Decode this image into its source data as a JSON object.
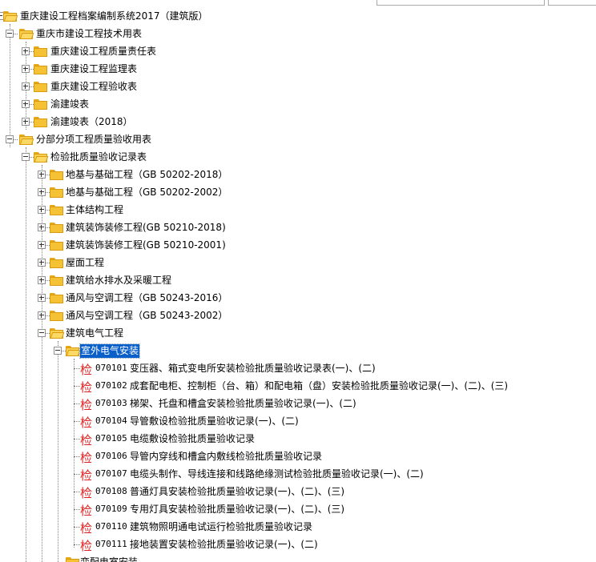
{
  "tree": {
    "root": "重庆建设工程档案编制系统2017（建筑版）",
    "group1": {
      "label": "重庆市建设工程技术用表",
      "items": [
        "重庆建设工程质量责任表",
        "重庆建设工程监理表",
        "重庆建设工程验收表",
        "渝建竣表",
        "渝建竣表（2018）"
      ]
    },
    "group2": {
      "label": "分部分项工程质量验收用表",
      "sub": {
        "label": "检验批质量验收记录表",
        "items": [
          "地基与基础工程（GB 50202-2018）",
          "地基与基础工程（GB 50202-2002）",
          "主体结构工程",
          "建筑装饰装修工程(GB 50210-2018)",
          "建筑装饰装修工程(GB 50210-2001)",
          "屋面工程",
          "建筑给水排水及采暖工程",
          "通风与空调工程（GB 50243-2016）",
          "通风与空调工程（GB 50243-2002）"
        ],
        "electrical": {
          "label": "建筑电气工程",
          "outdoor": {
            "label": "室外电气安装",
            "badge": "检",
            "records": [
              {
                "code": "070101",
                "name": "变压器、箱式变电所安装检验批质量验收记录表(一)、(二)"
              },
              {
                "code": "070102",
                "name": "成套配电柜、控制柜（台、箱）和配电箱（盘）安装检验批质量验收记录(一)、(二)、(三)"
              },
              {
                "code": "070103",
                "name": "梯架、托盘和槽盒安装检验批质量验收记录(一)、(二)"
              },
              {
                "code": "070104",
                "name": "导管敷设检验批质量验收记录(一)、(二)"
              },
              {
                "code": "070105",
                "name": "电缆敷设检验批质量验收记录"
              },
              {
                "code": "070106",
                "name": "导管内穿线和槽盒内敷线检验批质量验收记录"
              },
              {
                "code": "070107",
                "name": "电缆头制作、导线连接和线路绝缘测试检验批质量验收记录(一)、(二)"
              },
              {
                "code": "070108",
                "name": "普通灯具安装检验批质量验收记录(一)、(二)、(三)"
              },
              {
                "code": "070109",
                "name": "专用灯具安装检验批质量验收记录(一)、(二)、(三)"
              },
              {
                "code": "070110",
                "name": "建筑物照明通电试运行检验批质量验收记录"
              },
              {
                "code": "070111",
                "name": "接地装置安装检验批质量验收记录(一)、(二)"
              }
            ]
          },
          "next": "变配电室安装"
        }
      }
    }
  },
  "colors": {
    "selection": "#0a60c8",
    "badge": "#e02020",
    "folder": "#f5c236"
  }
}
